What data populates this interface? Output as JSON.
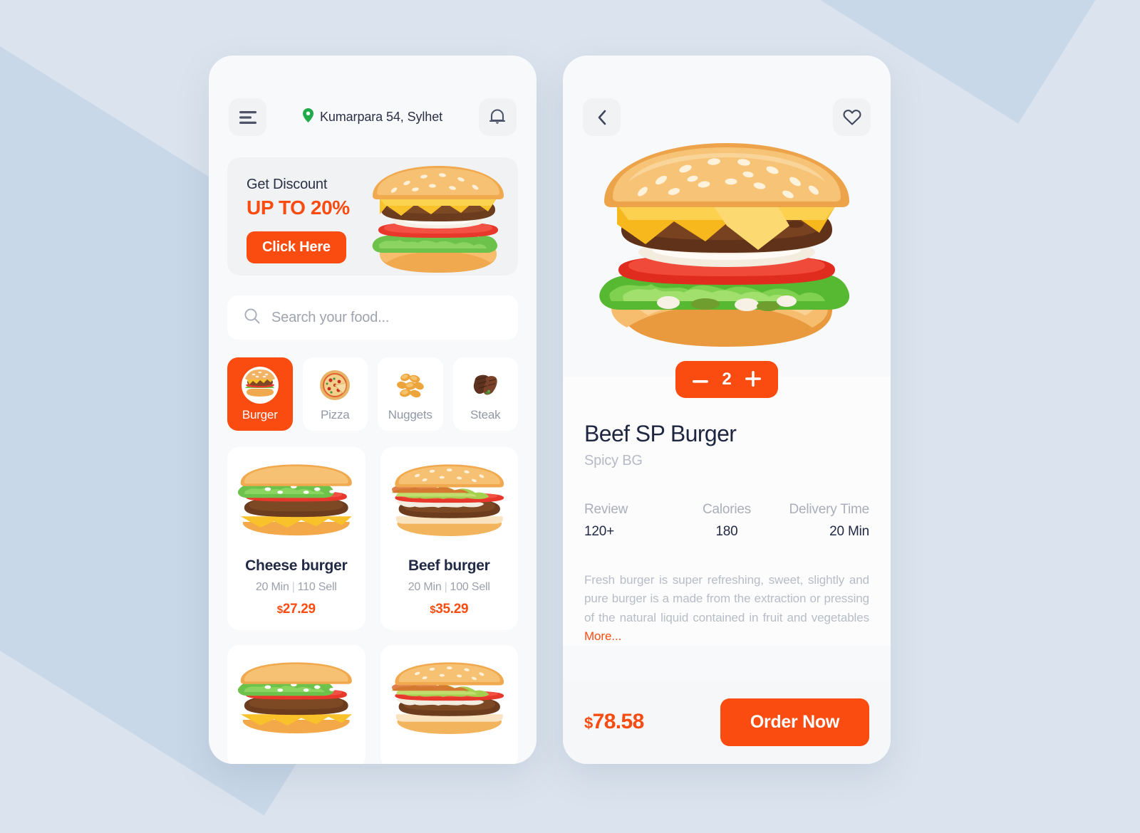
{
  "background": {
    "base_color": "#dbe4ee",
    "band_color": "#c9d8e8"
  },
  "theme": {
    "accent": "#fa4c10",
    "dark_text": "#222a45",
    "muted_text": "#9ba0ac",
    "pin_green": "#1fab4a",
    "phone_bg": "#f8f9fa"
  },
  "home": {
    "menu_icon": "hamburger-menu-icon",
    "location_icon": "location-pin-icon",
    "address": "Kumarpara 54, Sylhet",
    "bell_icon": "notification-bell-icon",
    "banner": {
      "title": "Get Discount",
      "subtitle": "UP TO 20%",
      "cta_label": "Click Here",
      "image": "cheeseburger-photo"
    },
    "search": {
      "icon": "search-icon",
      "placeholder": "Search your food...",
      "value": ""
    },
    "categories": [
      {
        "label": "Burger",
        "icon": "burger-icon",
        "active": true
      },
      {
        "label": "Pizza",
        "icon": "pizza-icon",
        "active": false
      },
      {
        "label": "Nuggets",
        "icon": "nuggets-icon",
        "active": false
      },
      {
        "label": "Steak",
        "icon": "steak-icon",
        "active": false
      }
    ],
    "products": [
      {
        "name": "Cheese burger",
        "time": "20 Min",
        "sold": "110 Sell",
        "currency": "$",
        "price": "27.29",
        "image": "cheese-burger-photo"
      },
      {
        "name": "Beef burger",
        "time": "20 Min",
        "sold": "100 Sell",
        "currency": "$",
        "price": "35.29",
        "image": "beef-burger-photo"
      },
      {
        "name": "",
        "time": "",
        "sold": "",
        "currency": "",
        "price": "",
        "image": "cheese-burger-photo"
      },
      {
        "name": "",
        "time": "",
        "sold": "",
        "currency": "",
        "price": "",
        "image": "beef-burger-photo"
      }
    ]
  },
  "detail": {
    "back_icon": "chevron-left-icon",
    "favorite_icon": "heart-icon",
    "hero_image": "beef-sp-burger-photo",
    "stepper": {
      "decrement_icon": "minus-icon",
      "quantity": "2",
      "increment_icon": "plus-icon"
    },
    "title": "Beef SP Burger",
    "subtitle": "Spicy BG",
    "stats": [
      {
        "label": "Review",
        "value": "120+"
      },
      {
        "label": "Calories",
        "value": "180"
      },
      {
        "label": "Delivery Time",
        "value": "20 Min"
      }
    ],
    "description": "Fresh burger is super refreshing, sweet, slightly and pure burger is a made from the extraction or pressing of the natural liquid contained in fruit and vegetables ",
    "more_label": "More...",
    "footer": {
      "currency": "$",
      "total": "78.58",
      "order_label": "Order Now"
    }
  }
}
